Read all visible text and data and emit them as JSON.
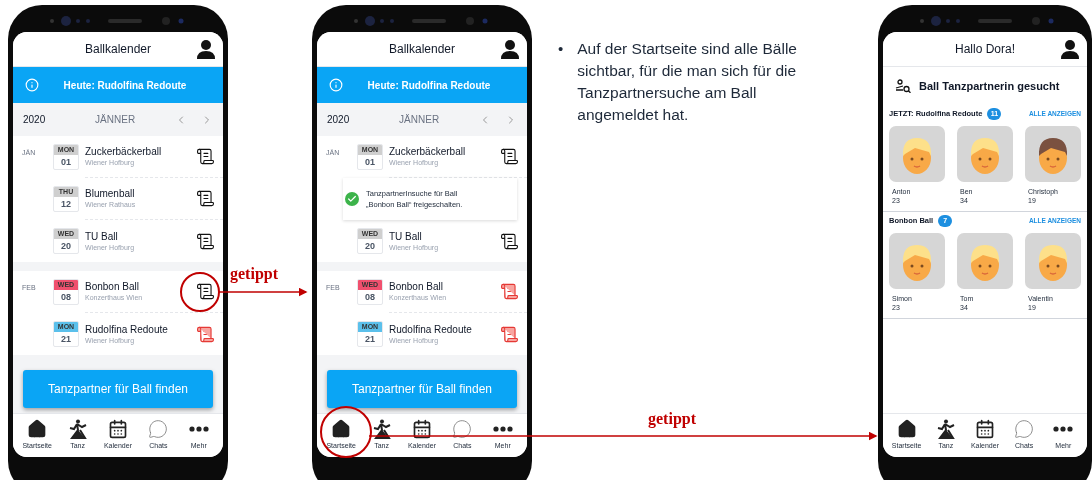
{
  "phones": [
    {
      "kind": "calendar",
      "header": "Ballkalender",
      "banner": "Heute: Rudolfina Redoute",
      "year": "2020",
      "month": "JÄNNER",
      "sections": [
        {
          "label": "JÄN",
          "items": [
            {
              "kind": "event",
              "weekday": "MON",
              "day": "01",
              "color": "#cfcfcf",
              "name": "Zuckerbäckerball",
              "venue": "Wiener Hofburg",
              "registered": false
            },
            {
              "kind": "event",
              "weekday": "THU",
              "day": "12",
              "color": "#cfcfcf",
              "name": "Blumenball",
              "venue": "Wiener Rathaus",
              "registered": false
            },
            {
              "kind": "event",
              "weekday": "WED",
              "day": "20",
              "color": "#cfcfcf",
              "name": "TU Ball",
              "venue": "Wiener Hofburg",
              "registered": false
            }
          ]
        },
        {
          "label": "FEB",
          "items": [
            {
              "kind": "event",
              "weekday": "WED",
              "day": "08",
              "color": "#f0506e",
              "name": "Bonbon Ball",
              "venue": "Konzerthaus Wien",
              "registered": false
            },
            {
              "kind": "event",
              "weekday": "MON",
              "day": "21",
              "color": "#5bc0eb",
              "name": "Rudolfina Redoute",
              "venue": "Wiener Hofburg",
              "registered": true
            }
          ]
        }
      ],
      "button": "Tanzpartner für Ball finden",
      "nav": [
        "Startseite",
        "Tanz",
        "Kalender",
        "Chats",
        "Mehr"
      ]
    },
    {
      "kind": "calendar",
      "header": "Ballkalender",
      "banner": "Heute: Rudolfina Redoute",
      "year": "2020",
      "month": "JÄNNER",
      "sections": [
        {
          "label": "JÄN",
          "items": [
            {
              "kind": "event",
              "weekday": "MON",
              "day": "01",
              "color": "#cfcfcf",
              "name": "Zuckerbäckerball",
              "venue": "Wiener Hofburg",
              "registered": false
            },
            {
              "kind": "toast",
              "lines": [
                "TanzpartnerInsuche für Ball",
                "„Bonbon Ball“ freigeschalten."
              ]
            },
            {
              "kind": "event",
              "weekday": "WED",
              "day": "20",
              "color": "#cfcfcf",
              "name": "TU Ball",
              "venue": "Wiener Hofburg",
              "registered": false
            }
          ]
        },
        {
          "label": "FEB",
          "items": [
            {
              "kind": "event",
              "weekday": "WED",
              "day": "08",
              "color": "#f0506e",
              "name": "Bonbon Ball",
              "venue": "Konzerthaus Wien",
              "registered": true
            },
            {
              "kind": "event",
              "weekday": "MON",
              "day": "21",
              "color": "#5bc0eb",
              "name": "Rudolfina Redoute",
              "venue": "Wiener Hofburg",
              "registered": true
            }
          ]
        }
      ],
      "button": "Tanzpartner für Ball finden",
      "nav": [
        "Startseite",
        "Tanz",
        "Kalender",
        "Chats",
        "Mehr"
      ]
    },
    {
      "kind": "home",
      "header": "Hallo Dora!",
      "title": "Ball Tanzpartnerin gesucht",
      "groups": [
        {
          "title": "JETZT: Rudolfina Redoute",
          "count": "11",
          "link": "ALLE ANZEIGEN",
          "people": [
            {
              "name": "Anton",
              "age": "23",
              "color": "#fde08a"
            },
            {
              "name": "Ben",
              "age": "34",
              "color": "#fde08a"
            },
            {
              "name": "Christoph",
              "age": "19",
              "color": "#7a5140"
            }
          ]
        },
        {
          "title": "Bonbon Ball",
          "count": "7",
          "link": "ALLE ANZEIGEN",
          "people": [
            {
              "name": "Simon",
              "age": "23",
              "color": "#fde08a"
            },
            {
              "name": "Tom",
              "age": "34",
              "color": "#fde08a"
            },
            {
              "name": "Valentin",
              "age": "19",
              "color": "#fde08a"
            }
          ]
        }
      ],
      "nav": [
        "Startseite",
        "Tanz",
        "Kalender",
        "Chats",
        "Mehr"
      ]
    }
  ],
  "note": {
    "bullet": "•",
    "text": "Auf der Startseite sind alle Bälle sichtbar, für die man sich für die Tanzpartnersuche am Ball angemeldet hat."
  },
  "annotations": [
    {
      "label": "getippt"
    },
    {
      "label": "getippt"
    }
  ]
}
